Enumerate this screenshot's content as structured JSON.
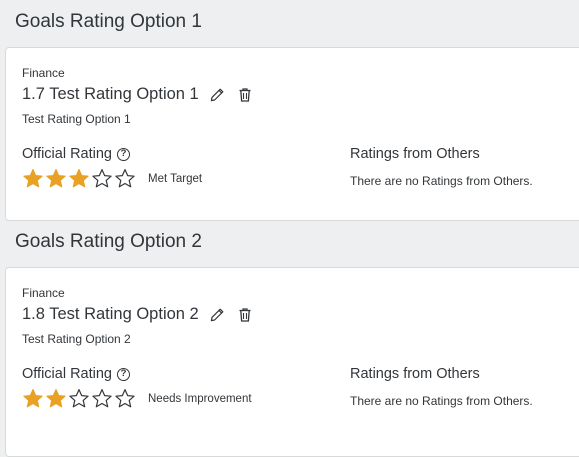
{
  "colors": {
    "page_background": "#edeff0",
    "card_background": "#ffffff",
    "star_filled": "#e9a125",
    "star_empty_outline": "#32363a",
    "text": "#32363a"
  },
  "icons": {
    "edit": "pencil-icon",
    "delete": "trash-icon",
    "help": "question-circle-icon",
    "star": "star-icon"
  },
  "sections": [
    {
      "title": "Goals Rating Option 1",
      "goal": {
        "category": "Finance",
        "title": "1.7 Test Rating Option 1",
        "description": "Test Rating Option 1"
      },
      "official_rating": {
        "label": "Official Rating",
        "help_glyph": "?",
        "stars_filled": 3,
        "stars_total": 5,
        "rating_text": "Met Target"
      },
      "others": {
        "label": "Ratings from Others",
        "empty_text": "There are no Ratings from Others."
      }
    },
    {
      "title": "Goals Rating Option 2",
      "goal": {
        "category": "Finance",
        "title": "1.8 Test Rating Option 2",
        "description": "Test Rating Option 2"
      },
      "official_rating": {
        "label": "Official Rating",
        "help_glyph": "?",
        "stars_filled": 2,
        "stars_total": 5,
        "rating_text": "Needs Improvement"
      },
      "others": {
        "label": "Ratings from Others",
        "empty_text": "There are no Ratings from Others."
      }
    }
  ]
}
